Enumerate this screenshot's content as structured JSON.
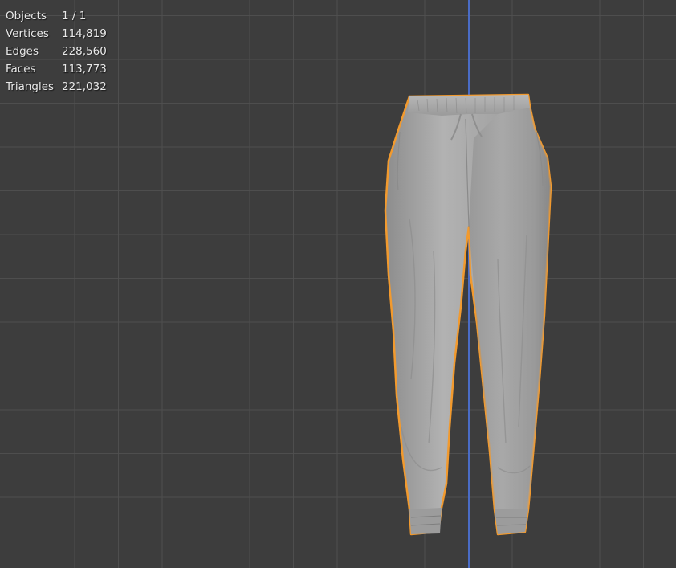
{
  "stats": [
    {
      "label": "Objects",
      "value": "1 / 1"
    },
    {
      "label": "Vertices",
      "value": "114,819"
    },
    {
      "label": "Edges",
      "value": "228,560"
    },
    {
      "label": "Faces",
      "value": "113,773"
    },
    {
      "label": "Triangles",
      "value": "221,032"
    }
  ],
  "colors": {
    "viewport_bg": "#3d3d3d",
    "grid_line": "#505050",
    "z_axis": "#4a6cc6",
    "selection_outline": "#f29a2e",
    "mesh": "#a6a6a6"
  },
  "selected_object_icon": "pants-mesh-icon"
}
